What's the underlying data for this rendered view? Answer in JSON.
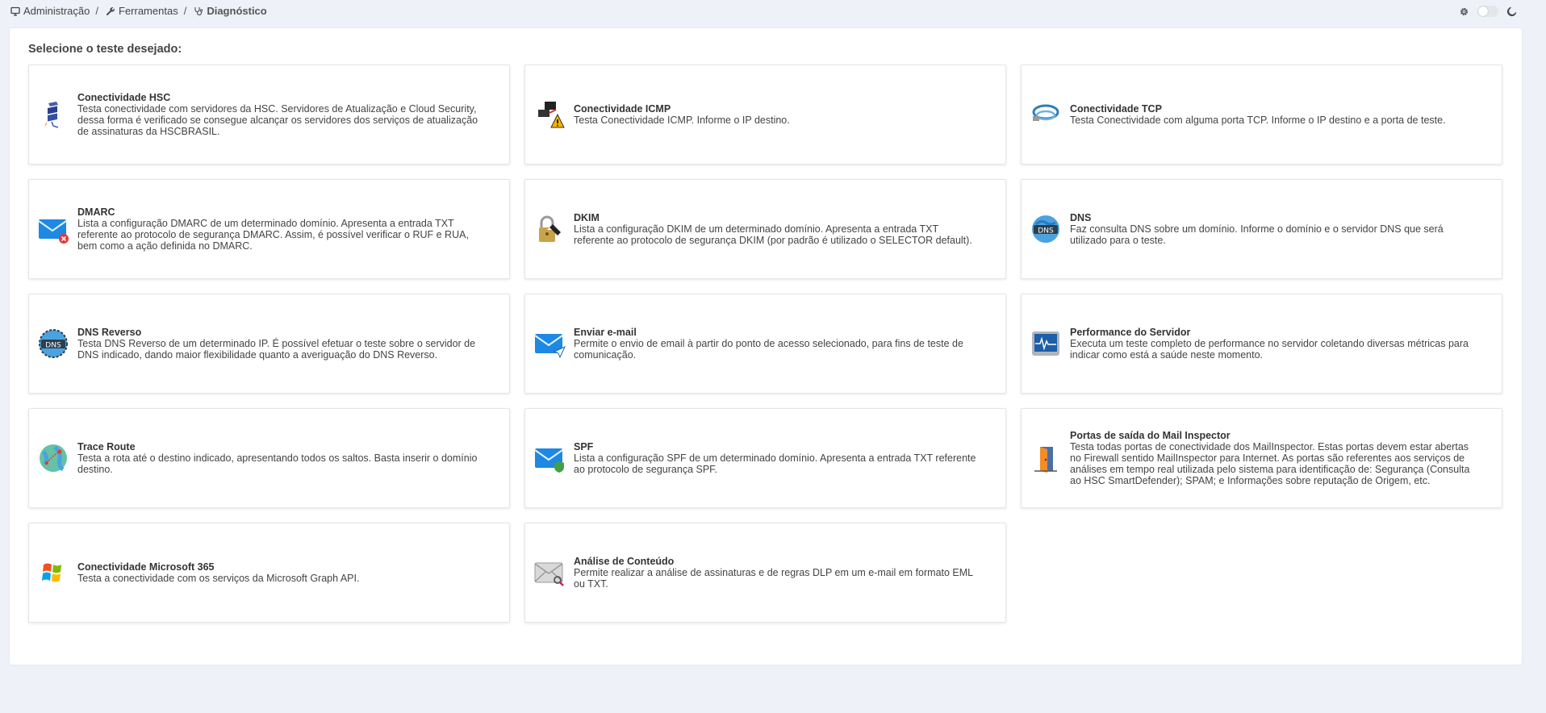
{
  "breadcrumb": {
    "items": [
      {
        "label": "Administração",
        "icon": "monitor-icon"
      },
      {
        "label": "Ferramentas",
        "icon": "wrench-icon"
      },
      {
        "label": "Diagnóstico",
        "icon": "stethoscope-icon"
      }
    ],
    "separator": "/"
  },
  "top_controls": {
    "settings_icon": "gear-icon",
    "theme_toggle": "toggle",
    "dark_icon": "moon-icon"
  },
  "panel": {
    "title": "Selecione o teste desejado:"
  },
  "tests": [
    {
      "title": "Conectividade HSC",
      "desc": "Testa conectividade com servidores da HSC. Servidores de Atualização e Cloud Security, dessa forma é verificado se consegue alcançar os servidores dos serviços de atualização de assinaturas da HSCBRASIL.",
      "icon": "server-icon"
    },
    {
      "title": "Conectividade ICMP",
      "desc": "Testa Conectividade ICMP. Informe o IP destino.",
      "icon": "network-warning-icon"
    },
    {
      "title": "Conectividade TCP",
      "desc": "Testa Conectividade com alguma porta TCP. Informe o IP destino e a porta de teste.",
      "icon": "cable-icon"
    },
    {
      "title": "DMARC",
      "desc": "Lista a configuração DMARC de um determinado domínio. Apresenta a entrada TXT referente ao protocolo de segurança DMARC. Assim, é possível verificar o RUF e RUA, bem como a ação definida no DMARC.",
      "icon": "mail-error-icon"
    },
    {
      "title": "DKIM",
      "desc": "Lista a configuração DKIM de um determinado domínio. Apresenta a entrada TXT referente ao protocolo de segurança DKIM (por padrão é utilizado o SELECTOR default).",
      "icon": "padlock-pen-icon"
    },
    {
      "title": "DNS",
      "desc": "Faz consulta DNS sobre um domínio. Informe o domínio e o servidor DNS que será utilizado para o teste.",
      "icon": "dns-globe-icon"
    },
    {
      "title": "DNS Reverso",
      "desc": "Testa DNS Reverso de um determinado IP. É possível efetuar o teste sobre o servidor de DNS indicado, dando maior flexibilidade quanto a averiguação do DNS Reverso.",
      "icon": "dns-reverse-icon"
    },
    {
      "title": "Enviar e-mail",
      "desc": "Permite o envio de email à partir do ponto de acesso selecionado, para fins de teste de comunicação.",
      "icon": "mail-send-icon"
    },
    {
      "title": "Performance do Servidor",
      "desc": "Executa um teste completo de performance no servidor coletando diversas métricas para indicar como está a saúde neste momento.",
      "icon": "performance-monitor-icon"
    },
    {
      "title": "Trace Route",
      "desc": "Testa a rota até o destino indicado, apresentando todos os saltos. Basta inserir o domínio destino.",
      "icon": "globe-route-icon"
    },
    {
      "title": "SPF",
      "desc": "Lista a configuração SPF de um determinado domínio. Apresenta a entrada TXT referente ao protocolo de segurança SPF.",
      "icon": "mail-shield-icon"
    },
    {
      "title": "Portas de saída do Mail Inspector",
      "desc": "Testa todas portas de conectividade dos MailInspector. Estas portas devem estar abertas no Firewall sentido MailInspector para Internet. As portas são referentes aos serviços de análises em tempo real utilizada pelo sistema para identificação de: Segurança (Consulta ao HSC SmartDefender); SPAM; e Informações sobre reputação de Origem, etc.",
      "icon": "door-icon"
    },
    {
      "title": "Conectividade Microsoft 365",
      "desc": "Testa a conectividade com os serviços da Microsoft Graph API.",
      "icon": "windows-logo-icon"
    },
    {
      "title": "Análise de Conteúdo",
      "desc": "Permite realizar a análise de assinaturas e de regras DLP em um e-mail em formato EML ou TXT.",
      "icon": "mail-search-icon"
    }
  ]
}
